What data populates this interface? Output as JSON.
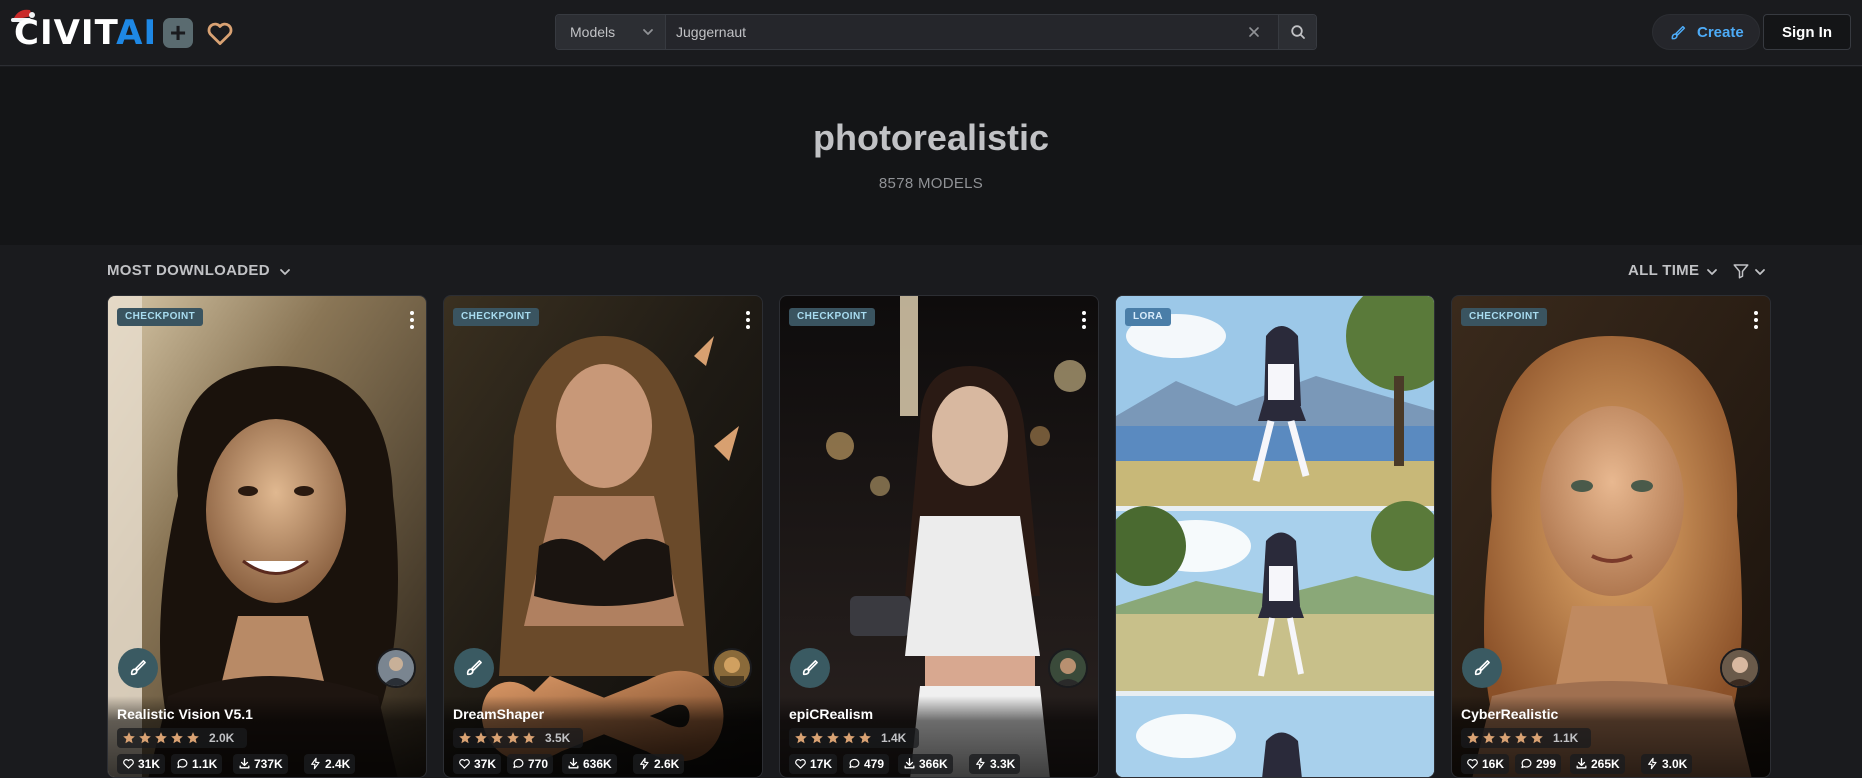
{
  "header": {
    "logo_text_a": "CIVIT",
    "logo_text_b": "AI",
    "search_type": "Models",
    "search_value": "Juggernaut",
    "create_label": "Create",
    "signin_label": "Sign In"
  },
  "hero": {
    "title": "photorealistic",
    "count": "8578 MODELS"
  },
  "controls": {
    "sort_label": "MOST DOWNLOADED",
    "period_label": "ALL TIME"
  },
  "colors": {
    "accent": "#4dabf7",
    "bg": "#1a1b1e",
    "hero_bg": "#141517",
    "badge_checkpoint": "#3a5460",
    "star": "#ffa94d"
  },
  "cards": [
    {
      "badge": "CHECKPOINT",
      "name": "Realistic Vision V5.1",
      "rating_count": "2.0K",
      "likes": "31K",
      "comments": "1.1K",
      "downloads": "737K",
      "tips": "2.4K",
      "rating": 5
    },
    {
      "badge": "CHECKPOINT",
      "name": "DreamShaper",
      "rating_count": "3.5K",
      "likes": "37K",
      "comments": "770",
      "downloads": "636K",
      "tips": "2.6K",
      "rating": 5
    },
    {
      "badge": "CHECKPOINT",
      "name": "epiCRealism",
      "rating_count": "1.4K",
      "likes": "17K",
      "comments": "479",
      "downloads": "366K",
      "tips": "3.3K",
      "rating": 5
    },
    {
      "badge": "LORA",
      "name": "",
      "rating_count": "",
      "likes": "",
      "comments": "",
      "downloads": "",
      "tips": ""
    },
    {
      "badge": "CHECKPOINT",
      "name": "CyberRealistic",
      "rating_count": "1.1K",
      "likes": "16K",
      "comments": "299",
      "downloads": "265K",
      "tips": "3.0K",
      "rating": 5
    }
  ]
}
